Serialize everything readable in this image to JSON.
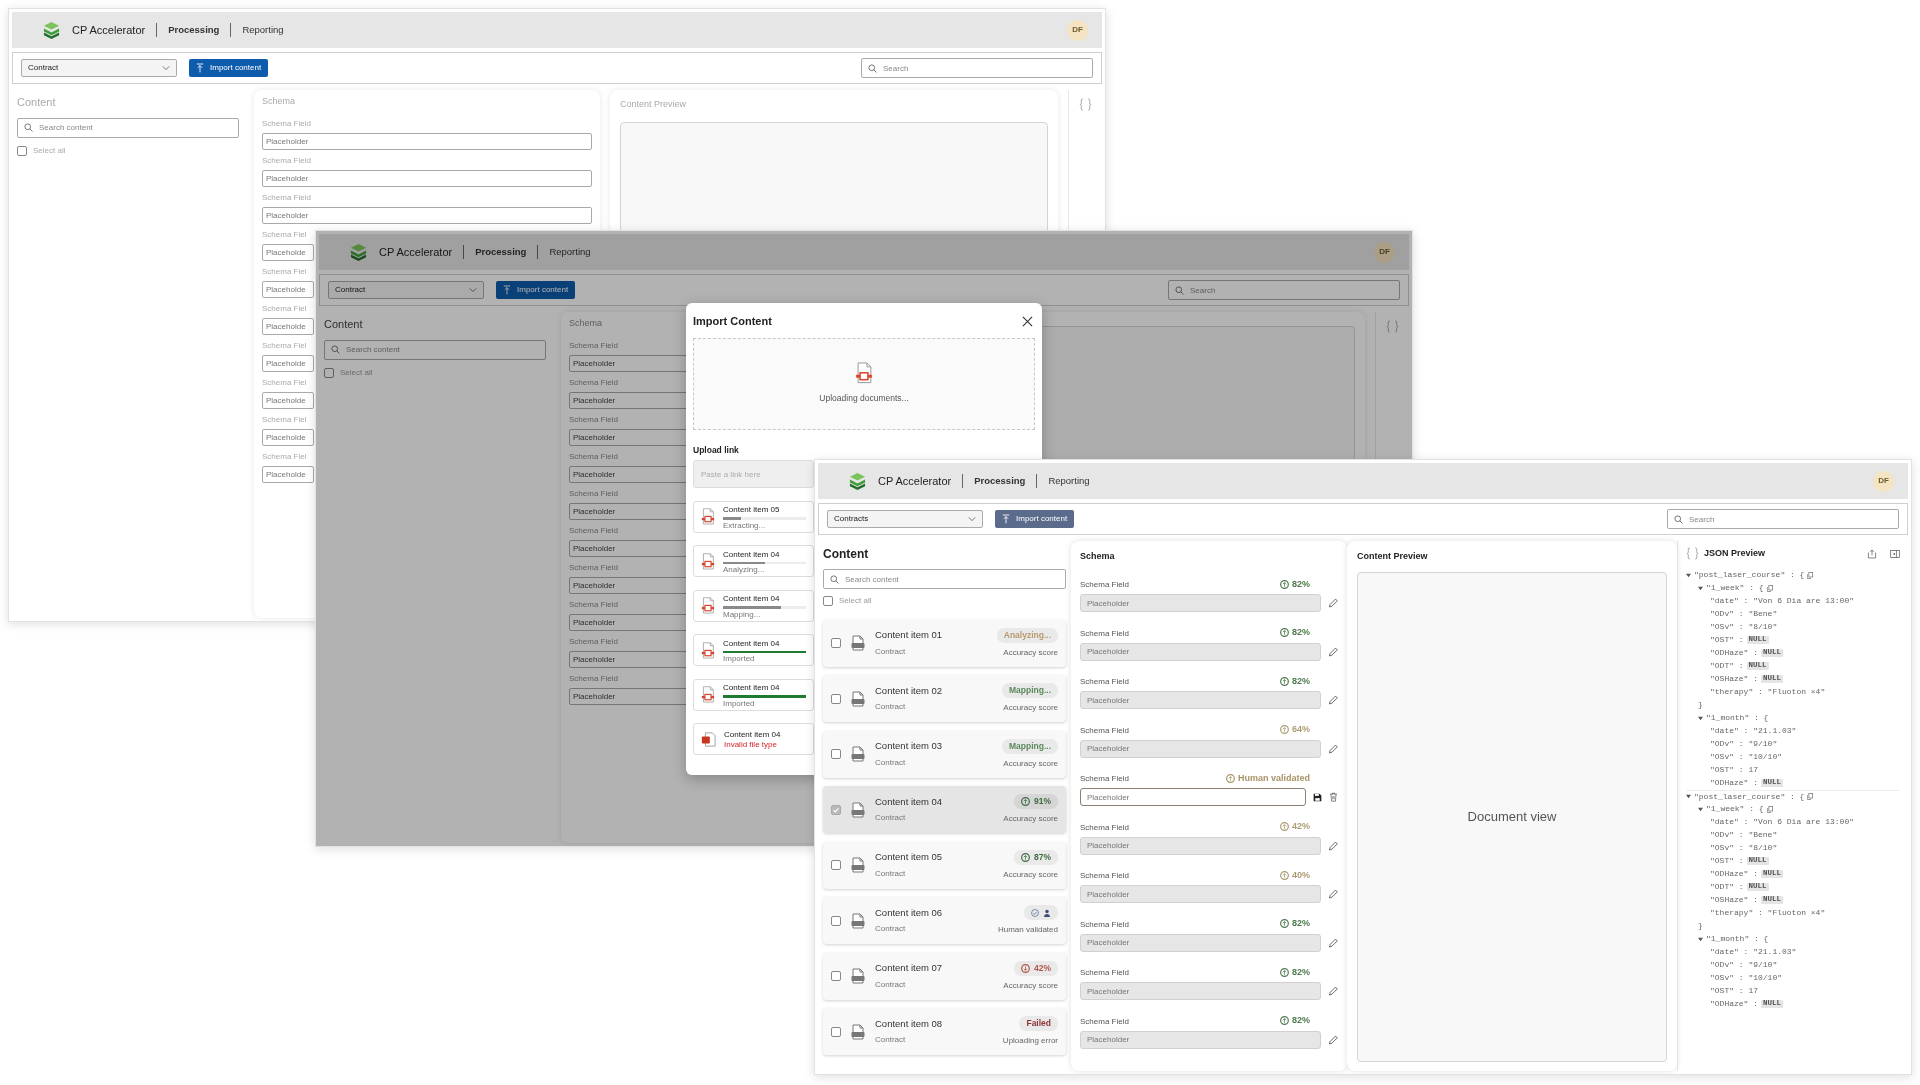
{
  "windows": [
    {
      "kind": "basic",
      "faded": true,
      "dimmed": false,
      "header": {
        "app_title": "CP Accelerator",
        "nav": [
          {
            "label": "Processing",
            "selected": true
          },
          {
            "label": "Reporting",
            "selected": false
          }
        ],
        "avatar": "DF"
      },
      "toolbar": {
        "dropdown": "Contract",
        "import_button": "Import content",
        "search": {
          "placeholder": "Search"
        }
      },
      "content": {
        "title": "Content",
        "search": {
          "placeholder": "Search content"
        },
        "select_all": {
          "label": "Select all",
          "checked": false
        }
      },
      "schema": {
        "title": "Schema",
        "fields": [
          {
            "label": "Schema Field",
            "placeholder": "Placeholder"
          },
          {
            "label": "Schema Field",
            "placeholder": "Placeholder"
          },
          {
            "label": "Schema Field",
            "placeholder": "Placeholder"
          },
          {
            "label": "Schema Fiel",
            "placeholder": "Placeholde"
          },
          {
            "label": "Schema Fiel",
            "placeholder": "Placeholde"
          },
          {
            "label": "Schema Fiel",
            "placeholder": "Placeholde"
          },
          {
            "label": "Schema Fiel",
            "placeholder": "Placeholde"
          },
          {
            "label": "Schema Fiel",
            "placeholder": "Placeholde"
          },
          {
            "label": "Schema Fiel",
            "placeholder": "Placeholde"
          },
          {
            "label": "Schema Fiel",
            "placeholder": "Placeholde"
          }
        ]
      },
      "preview": {
        "title": "Content Preview"
      }
    },
    {
      "kind": "basic",
      "faded": false,
      "dimmed": true,
      "header": {
        "app_title": "CP Accelerator",
        "nav": [
          {
            "label": "Processing",
            "selected": true
          },
          {
            "label": "Reporting",
            "selected": false
          }
        ],
        "avatar": "DF"
      },
      "toolbar": {
        "dropdown": "Contract",
        "import_button": "Import content",
        "search": {
          "placeholder": "Search"
        }
      },
      "content": {
        "title": "Content",
        "search": {
          "placeholder": "Search content"
        },
        "select_all": {
          "label": "Select all",
          "checked": false
        }
      },
      "schema": {
        "title": "Schema",
        "fields": [
          {
            "label": "Schema Field",
            "placeholder": "Placeholder"
          },
          {
            "label": "Schema Field",
            "placeholder": "Placeholder"
          },
          {
            "label": "Schema Field",
            "placeholder": "Placeholder"
          },
          {
            "label": "Schema Field",
            "placeholder": "Placeholder"
          },
          {
            "label": "Schema Field",
            "placeholder": "Placeholder"
          },
          {
            "label": "Schema Field",
            "placeholder": "Placeholder"
          },
          {
            "label": "Schema Field",
            "placeholder": "Placeholder"
          },
          {
            "label": "Schema Field",
            "placeholder": "Placeholder"
          },
          {
            "label": "Schema Field",
            "placeholder": "Placeholder"
          },
          {
            "label": "Schema Field",
            "placeholder": "Placeholder"
          }
        ]
      },
      "dialog": {
        "title": "Import Content",
        "upload_status": "Uploading documents...",
        "link": {
          "label": "Upload link",
          "placeholder": "Paste a link here"
        },
        "uploads": [
          {
            "kind": "progress",
            "name": "Content item 05",
            "status": "Extracting...",
            "level": 0.22
          },
          {
            "kind": "progress",
            "name": "Content item 04",
            "status": "Analyzing...",
            "level": 0.5
          },
          {
            "kind": "progress",
            "name": "Content item 04",
            "status": "Mapping...",
            "level": 0.7
          },
          {
            "kind": "done",
            "name": "Content item 04",
            "status": "Imported",
            "level": 1
          },
          {
            "kind": "done",
            "name": "Content item 04",
            "status": "Imported",
            "level": 1
          },
          {
            "kind": "error",
            "name": "Content item 04",
            "status": "Invalid file type"
          }
        ]
      }
    },
    {
      "kind": "detailed",
      "faded": false,
      "dimmed": false,
      "header": {
        "app_title": "CP Accelerator",
        "nav": [
          {
            "label": "Processing",
            "selected": true
          },
          {
            "label": "Reporting",
            "selected": false
          }
        ],
        "avatar": "DF"
      },
      "toolbar": {
        "dropdown": "Contracts",
        "import_button": "Import content",
        "search": {
          "placeholder": "Search"
        }
      },
      "content": {
        "title": "Content",
        "search": {
          "placeholder": "Search content"
        },
        "select_all": {
          "label": "Select all",
          "checked": false
        },
        "items": [
          {
            "kind": "status",
            "name": "Content item 01",
            "subtitle": "Contract",
            "badge": "Analyzing...",
            "color": "#b89a6e",
            "caption": "Accuracy score",
            "checked": false,
            "selected": false
          },
          {
            "kind": "status",
            "name": "Content item 02",
            "subtitle": "Contract",
            "badge": "Mapping...",
            "color": "#5a8a5a",
            "caption": "Accuracy score",
            "checked": false,
            "selected": false
          },
          {
            "kind": "status",
            "name": "Content item 03",
            "subtitle": "Contract",
            "badge": "Mapping...",
            "color": "#5a8a5a",
            "caption": "Accuracy score",
            "checked": false,
            "selected": false
          },
          {
            "kind": "score_up",
            "name": "Content item 04",
            "subtitle": "Contract",
            "badge": "91%",
            "color": "#3f6b3f",
            "caption": "Accuracy score",
            "checked": true,
            "selected": true
          },
          {
            "kind": "score_up",
            "name": "Content item 05",
            "subtitle": "Contract",
            "badge": "87%",
            "color": "#3f6b3f",
            "caption": "Accuracy score",
            "checked": false,
            "selected": false
          },
          {
            "kind": "human",
            "name": "Content item 06",
            "subtitle": "Contract",
            "caption": "Human validated",
            "checked": false,
            "selected": false
          },
          {
            "kind": "score_down",
            "name": "Content item 07",
            "subtitle": "Contract",
            "badge": "42%",
            "color": "#b0564a",
            "caption": "Accuracy score",
            "checked": false,
            "selected": false
          },
          {
            "kind": "status",
            "name": "Content item 08",
            "subtitle": "Contract",
            "badge": "Failed",
            "color": "#8f3434",
            "caption": "Uploading error",
            "checked": false,
            "selected": false
          }
        ]
      },
      "schema": {
        "title": "Schema",
        "fields": [
          {
            "label": "Schema Field",
            "score": "82%",
            "color": "#4d7a4d",
            "placeholder": "Placeholder",
            "editing": false
          },
          {
            "label": "Schema Field",
            "score": "82%",
            "color": "#4d7a4d",
            "placeholder": "Placeholder",
            "editing": false
          },
          {
            "label": "Schema Field",
            "score": "82%",
            "color": "#4d7a4d",
            "placeholder": "Placeholder",
            "editing": false
          },
          {
            "label": "Schema Field",
            "score": "64%",
            "color": "#ad9c73",
            "placeholder": "Placeholder",
            "editing": false
          },
          {
            "label": "Schema Field",
            "score": "Human validated",
            "color": "#a8946a",
            "placeholder": "Placeholder",
            "editing": true
          },
          {
            "label": "Schema Field",
            "score": "42%",
            "color": "#ad9c73",
            "placeholder": "Placeholder",
            "editing": false
          },
          {
            "label": "Schema Field",
            "score": "40%",
            "color": "#ad9c73",
            "placeholder": "Placeholder",
            "editing": false
          },
          {
            "label": "Schema Field",
            "score": "82%",
            "color": "#4d7a4d",
            "placeholder": "Placeholder",
            "editing": false
          },
          {
            "label": "Schema Field",
            "score": "82%",
            "color": "#4d7a4d",
            "placeholder": "Placeholder",
            "editing": false
          },
          {
            "label": "Schema Field",
            "score": "82%",
            "color": "#4d7a4d",
            "placeholder": "Placeholder",
            "editing": false
          }
        ]
      },
      "preview": {
        "title": "Content Preview",
        "document_label": "Document view"
      },
      "json_preview": {
        "title": "JSON Preview",
        "tree": [
          {
            "text": "\"post_laser_course\" : {",
            "expanded": true,
            "copy": true,
            "children": [
              {
                "text": "\"1_week\" : {",
                "expanded": true,
                "copy": true,
                "children": [
                  {
                    "text": "\"date\" : \"Von 6 Dia are 13:00\""
                  },
                  {
                    "text": "\"ODv\" : \"Bene\""
                  },
                  {
                    "text": "\"OSv\" : \"8/10\""
                  },
                  {
                    "text": "\"OST\" :",
                    "badge": "NULL"
                  },
                  {
                    "text": "\"ODHaze\" :",
                    "badge": "NULL"
                  },
                  {
                    "text": "\"ODT\" :",
                    "badge": "NULL"
                  },
                  {
                    "text": "\"OSHaze\" :",
                    "badge": "NULL"
                  },
                  {
                    "text": "\"therapy\" : \"Fluoton ×4\""
                  }
                ]
              },
              {
                "text": "}"
              },
              {
                "text": "\"1_month\" : {",
                "expanded": true,
                "copy": false,
                "children": [
                  {
                    "text": "\"date\" : \"21.1.03\""
                  },
                  {
                    "text": "\"ODv\" : \"9/10\""
                  },
                  {
                    "text": "\"OSv\" : \"10/10\""
                  },
                  {
                    "text": "\"OST\" : 17"
                  },
                  {
                    "text": "\"ODHaze\" :",
                    "badge": "NULL"
                  }
                ]
              }
            ]
          },
          {
            "text": "\"post_laser_course\" : {",
            "expanded": true,
            "copy": true,
            "children": [
              {
                "text": "\"1_week\" : {",
                "expanded": true,
                "copy": true,
                "children": [
                  {
                    "text": "\"date\" : \"Von 6 Dia are 13:00\""
                  },
                  {
                    "text": "\"ODv\" : \"Bene\""
                  },
                  {
                    "text": "\"OSv\" : \"8/10\""
                  },
                  {
                    "text": "\"OST\" :",
                    "badge": "NULL"
                  },
                  {
                    "text": "\"ODHaze\" :",
                    "badge": "NULL"
                  },
                  {
                    "text": "\"ODT\" :",
                    "badge": "NULL"
                  },
                  {
                    "text": "\"OSHaze\" :",
                    "badge": "NULL"
                  },
                  {
                    "text": "\"therapy\" : \"Fluoton ×4\""
                  }
                ]
              },
              {
                "text": "}"
              },
              {
                "text": "\"1_month\" : {",
                "expanded": true,
                "copy": false,
                "children": [
                  {
                    "text": "\"date\" : \"21.1.03\""
                  },
                  {
                    "text": "\"ODv\" : \"9/10\""
                  },
                  {
                    "text": "\"OSv\" : \"10/10\""
                  },
                  {
                    "text": "\"OST\" : 17"
                  },
                  {
                    "text": "\"ODHaze\" :",
                    "badge": "NULL"
                  }
                ]
              }
            ]
          }
        ]
      }
    }
  ]
}
